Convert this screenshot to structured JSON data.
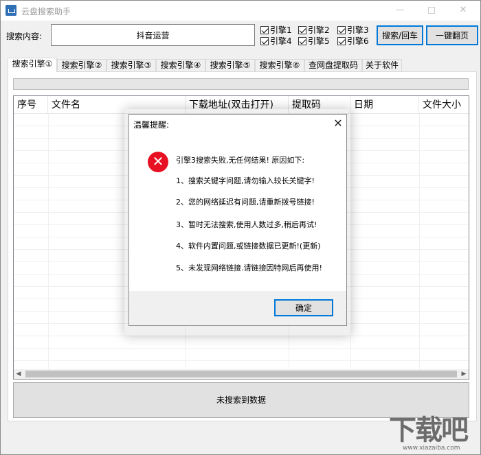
{
  "window": {
    "title": "云盘搜索助手",
    "controls": {
      "minimize": "—",
      "close": "✕"
    }
  },
  "search": {
    "label": "搜索内容:",
    "value": "抖音运营"
  },
  "engines": [
    {
      "label": "引擎1",
      "checked": true
    },
    {
      "label": "引擎2",
      "checked": true
    },
    {
      "label": "引擎3",
      "checked": true
    },
    {
      "label": "引擎4",
      "checked": true
    },
    {
      "label": "引擎5",
      "checked": true
    },
    {
      "label": "引擎6",
      "checked": true
    }
  ],
  "buttons": {
    "search": "搜索/回车",
    "page": "一键翻页"
  },
  "tabs": [
    {
      "label": "搜索引擎①",
      "active": true
    },
    {
      "label": "搜索引擎②"
    },
    {
      "label": "搜索引擎③"
    },
    {
      "label": "搜索引擎④"
    },
    {
      "label": "搜索引擎⑤"
    },
    {
      "label": "搜索引擎⑥"
    },
    {
      "label": "查网盘提取码"
    },
    {
      "label": "关于软件"
    }
  ],
  "progress": 0,
  "table": {
    "columns": [
      "序号",
      "文件名",
      "下载地址(双击打开)",
      "提取码",
      "日期",
      "文件大小"
    ],
    "rows": []
  },
  "status": "未搜索到数据",
  "dialog": {
    "title": "温馨提醒:",
    "close": "✕",
    "icon": "error-icon",
    "lines": [
      "引擎3搜索失败,无任何结果!  原因如下:",
      "1、搜索关键字问题,请勿输入较长关键字!",
      "2、您的网络延迟有问题,请重新拨号链接!",
      "3、暂时无法搜索,使用人数过多,稍后再试!",
      "4、软件内置问题,或链接数据已更新!(更新)",
      "5、未发现网络链接.请链接因特网后再使用!"
    ],
    "ok": "确定"
  },
  "watermark": {
    "big": "下载吧",
    "small": "www.xiazaiba.com"
  },
  "colors": {
    "accent": "#0078d7",
    "error": "#e81123"
  }
}
